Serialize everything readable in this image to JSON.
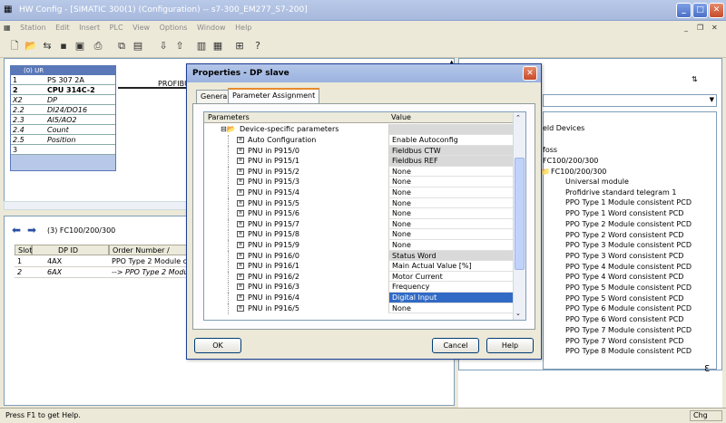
{
  "window": {
    "title": "HW Config - [SIMATIC 300(1) (Configuration) -- s7-300_EM277_S7-200]",
    "controls": {
      "minimize": "_",
      "maximize": "□",
      "close": "✕"
    },
    "mdi_controls": {
      "minimize": "_",
      "restore": "❐",
      "close": "✕"
    }
  },
  "menu": [
    "Station",
    "Edit",
    "Insert",
    "PLC",
    "View",
    "Options",
    "Window",
    "Help"
  ],
  "rack": {
    "title": "(0) UR",
    "rows": [
      {
        "slot": "1",
        "module": "PS 307 2A"
      },
      {
        "slot": "2",
        "module": "CPU 314C-2"
      },
      {
        "slot": "X2",
        "module": "DP"
      },
      {
        "slot": "2.2",
        "module": "DI24/DO16"
      },
      {
        "slot": "2.3",
        "module": "AI5/AO2"
      },
      {
        "slot": "2.4",
        "module": "Count"
      },
      {
        "slot": "2.5",
        "module": "Position"
      },
      {
        "slot": "3",
        "module": ""
      }
    ],
    "profibus_label": "PROFIBU"
  },
  "detail": {
    "title": "(3)   FC100/200/300",
    "columns": [
      "Slot",
      "DP ID",
      "Order Number / Design"
    ],
    "rows": [
      {
        "slot": "1",
        "dp_id": "4AX",
        "order": "PPO Type 2 Module cor"
      },
      {
        "slot": "2",
        "dp_id": "6AX",
        "order": "--> PPO Type 2 Module"
      }
    ]
  },
  "dialog": {
    "title": "Properties - DP slave",
    "close": "✕",
    "tabs": [
      "General",
      "Parameter Assignment"
    ],
    "columns": {
      "parameters": "Parameters",
      "value": "Value"
    },
    "root": "Device-specific parameters",
    "rows": [
      {
        "name": "Auto Configuration",
        "value": "Enable Autoconfig",
        "state": "normal"
      },
      {
        "name": "PNU in P915/0",
        "value": "Fieldbus CTW",
        "state": "gray"
      },
      {
        "name": "PNU in P915/1",
        "value": "Fieldbus REF",
        "state": "gray"
      },
      {
        "name": "PNU in P915/2",
        "value": "None",
        "state": "normal"
      },
      {
        "name": "PNU in P915/3",
        "value": "None",
        "state": "normal"
      },
      {
        "name": "PNU in P915/4",
        "value": "None",
        "state": "normal"
      },
      {
        "name": "PNU in P915/5",
        "value": "None",
        "state": "normal"
      },
      {
        "name": "PNU in P915/6",
        "value": "None",
        "state": "normal"
      },
      {
        "name": "PNU in P915/7",
        "value": "None",
        "state": "normal"
      },
      {
        "name": "PNU in P915/8",
        "value": "None",
        "state": "normal"
      },
      {
        "name": "PNU in P915/9",
        "value": "None",
        "state": "normal"
      },
      {
        "name": "PNU in P916/0",
        "value": "Status Word",
        "state": "gray"
      },
      {
        "name": "PNU in P916/1",
        "value": "Main Actual Value [%]",
        "state": "normal"
      },
      {
        "name": "PNU in P916/2",
        "value": "Motor Current",
        "state": "normal"
      },
      {
        "name": "PNU in P916/3",
        "value": "Frequency",
        "state": "normal"
      },
      {
        "name": "PNU in P916/4",
        "value": "Digital Input",
        "state": "selected"
      },
      {
        "name": "PNU in P916/5",
        "value": "None",
        "state": "normal"
      }
    ],
    "buttons": {
      "ok": "OK",
      "cancel": "Cancel",
      "help": "Help"
    }
  },
  "catalog": {
    "header_items": [
      "eld Devices",
      "foss",
      "FC100/200/300",
      "FC100/200/300"
    ],
    "items": [
      "Universal module",
      "Profidrive standard telegram 1",
      "PPO Type 1 Module consistent PCD",
      "PPO Type 1 Word consistent PCD",
      "PPO Type 2 Module consistent PCD",
      "PPO Type 2 Word consistent PCD",
      "PPO Type 3 Module consistent PCD",
      "PPO Type 3 Word consistent PCD",
      "PPO Type 4 Module consistent PCD",
      "PPO Type 4 Word consistent PCD",
      "PPO Type 5 Module consistent PCD",
      "PPO Type 5 Word consistent PCD",
      "PPO Type 6 Module consistent PCD",
      "PPO Type 6 Word consistent PCD",
      "PPO Type 7 Module consistent PCD",
      "PPO Type 7 Word consistent PCD",
      "PPO Type 8 Module consistent PCD"
    ]
  },
  "status": {
    "help": "Press F1 to get Help.",
    "mode": "Chg"
  }
}
